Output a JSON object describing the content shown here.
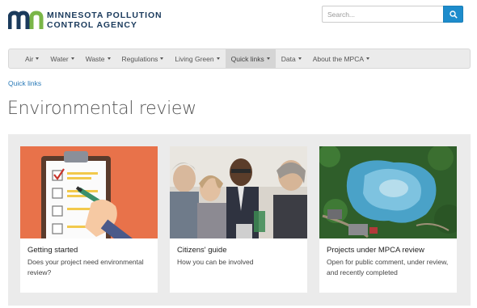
{
  "header": {
    "logo_line1": "MINNESOTA POLLUTION",
    "logo_line2": "CONTROL AGENCY",
    "search_placeholder": "Search..."
  },
  "nav": {
    "items": [
      {
        "label": "Air",
        "dropdown": true
      },
      {
        "label": "Water",
        "dropdown": true
      },
      {
        "label": "Waste",
        "dropdown": true
      },
      {
        "label": "Regulations",
        "dropdown": true
      },
      {
        "label": "Living Green",
        "dropdown": true
      },
      {
        "label": "Quick links",
        "dropdown": true,
        "active": true
      },
      {
        "label": "Data",
        "dropdown": true
      },
      {
        "label": "About the MPCA",
        "dropdown": true
      }
    ]
  },
  "breadcrumb": "Quick links",
  "page_title": "Environmental review",
  "cards": [
    {
      "title": "Getting started",
      "desc": "Does your project need environmental review?"
    },
    {
      "title": "Citizens' guide",
      "desc": "How you can be involved"
    },
    {
      "title": "Projects under MPCA review",
      "desc": "Open for public comment, under review, and recently completed"
    }
  ],
  "colors": {
    "brand_blue": "#1a3a5c",
    "brand_green": "#7ab648",
    "link": "#2a7ab8",
    "button": "#1d8ccc",
    "nav_bg": "#ebebeb",
    "nav_active": "#d5d5d5"
  }
}
